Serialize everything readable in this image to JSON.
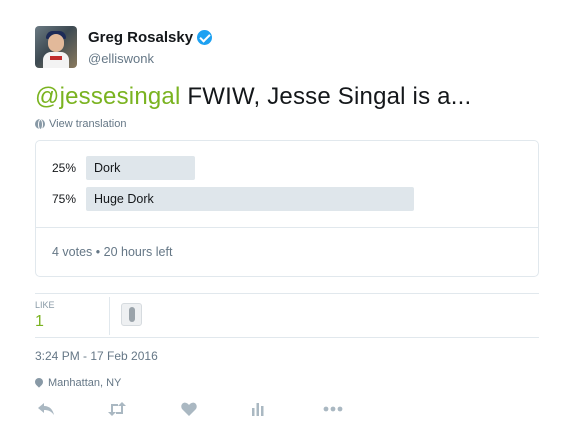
{
  "author": {
    "name": "Greg Rosalsky",
    "handle": "@elliswonk",
    "verified": true
  },
  "tweet": {
    "mention": "@jessesingal",
    "text": " FWIW, Jesse Singal is a...",
    "view_translation": "View translation"
  },
  "poll": {
    "options": [
      {
        "percent_label": "25%",
        "label": "Dork",
        "percent": 25
      },
      {
        "percent_label": "75%",
        "label": "Huge Dork",
        "percent": 75
      }
    ],
    "footer": "4 votes • 20 hours left"
  },
  "stats": {
    "likes_label": "LIKE",
    "likes_count": "1"
  },
  "meta": {
    "timestamp": "3:24 PM - 17 Feb 2016",
    "location": "Manhattan, NY"
  },
  "colors": {
    "mention": "#7ab320",
    "verified": "#1da1f2",
    "poll_bar": "#dfe6eb",
    "muted_text": "#657786",
    "action_icons": "#aab8c2"
  },
  "actions": [
    "reply-icon",
    "retweet-icon",
    "like-icon",
    "analytics-icon",
    "more-icon"
  ]
}
